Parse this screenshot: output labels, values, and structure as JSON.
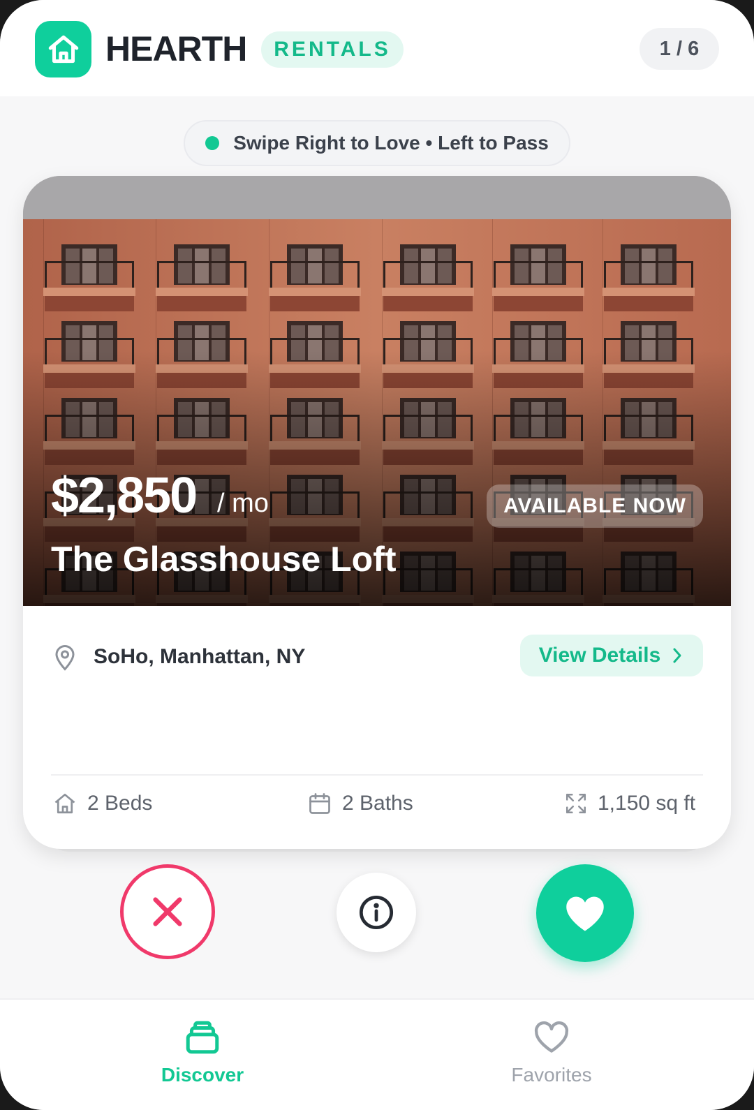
{
  "header": {
    "brand": "HEARTH",
    "badge": "RENTALS",
    "counter": "1 / 6",
    "logo_icon": "house-icon"
  },
  "hint": {
    "text": "Swipe Right to Love • Left to Pass"
  },
  "listing": {
    "price": "$2,850",
    "period": "/ mo",
    "status": "AVAILABLE NOW",
    "title": "The Glasshouse Loft",
    "location": "SoHo, Manhattan, NY",
    "details_label": "View Details",
    "stats": {
      "beds": "2 Beds",
      "baths": "2 Baths",
      "area": "1,150 sq ft"
    }
  },
  "actions": {
    "pass_icon": "close-icon",
    "info_icon": "info-icon",
    "love_icon": "heart-icon"
  },
  "nav": {
    "discover": "Discover",
    "favorites": "Favorites"
  },
  "colors": {
    "accent": "#0fcf9c",
    "pass": "#f0396a",
    "text_dark": "#1f232b",
    "muted": "#9ea3ab"
  }
}
